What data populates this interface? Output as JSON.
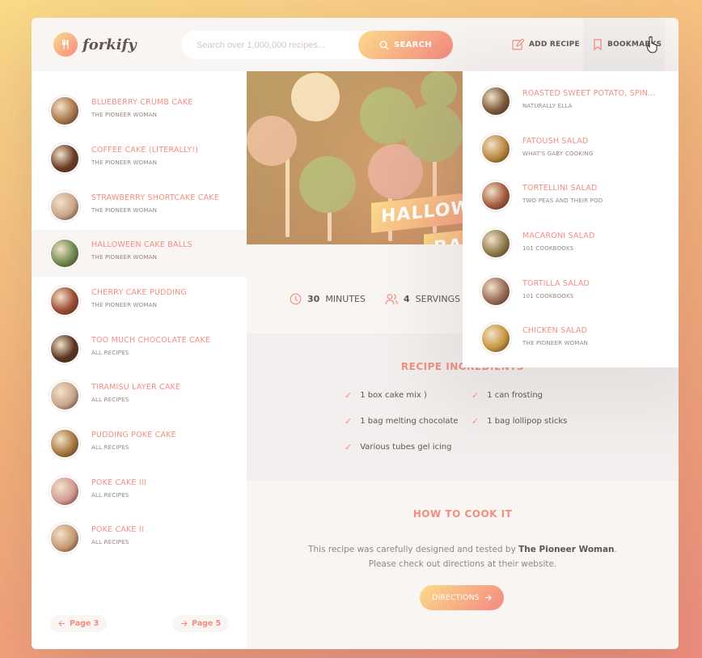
{
  "header": {
    "logo_text": "forkify",
    "search_placeholder": "Search over 1,000,000 recipes...",
    "search_label": "SEARCH",
    "add_recipe_label": "ADD RECIPE",
    "bookmarks_label": "BOOKMARKS"
  },
  "results": [
    {
      "title": "BLUEBERRY CRUMB CAKE",
      "publisher": "THE PIONEER WOMAN",
      "color": "#a9774d"
    },
    {
      "title": "COFFEE CAKE (LITERALLY!)",
      "publisher": "THE PIONEER WOMAN",
      "color": "#6b3c26"
    },
    {
      "title": "STRAWBERRY SHORTCAKE CAKE",
      "publisher": "THE PIONEER WOMAN",
      "color": "#c9a58b"
    },
    {
      "title": "HALLOWEEN CAKE BALLS",
      "publisher": "THE PIONEER WOMAN",
      "color": "#6e8a4e"
    },
    {
      "title": "CHERRY CAKE PUDDING",
      "publisher": "THE PIONEER WOMAN",
      "color": "#9b4a32"
    },
    {
      "title": "TOO MUCH CHOCOLATE CAKE",
      "publisher": "ALL RECIPES",
      "color": "#5b3320"
    },
    {
      "title": "TIRAMISU LAYER CAKE",
      "publisher": "ALL RECIPES",
      "color": "#c9a48c"
    },
    {
      "title": "PUDDING POKE CAKE",
      "publisher": "ALL RECIPES",
      "color": "#a8773f"
    },
    {
      "title": "POKE CAKE III",
      "publisher": "ALL RECIPES",
      "color": "#d39a94"
    },
    {
      "title": "POKE CAKE II",
      "publisher": "ALL RECIPES",
      "color": "#c69a74"
    }
  ],
  "pagination": {
    "prev": "Page 3",
    "next": "Page 5"
  },
  "recipe": {
    "title_line1": "HALLOWEEN",
    "title_line2": "BALLS",
    "minutes": "30",
    "minutes_label": "MINUTES",
    "servings": "4",
    "servings_label": "SERVINGS",
    "ingredients_title": "RECIPE INGREDIENTS",
    "ingredients": [
      "1 box cake mix )",
      "1 can frosting",
      "1 bag melting chocolate",
      "1 bag lollipop sticks",
      "Various tubes gel icing"
    ],
    "cook_title": "HOW TO COOK IT",
    "cook_text_1": "This recipe was carefully designed and tested by ",
    "cook_publisher": "The Pioneer Woman",
    "cook_text_2": ". Please check out directions at their website.",
    "directions_label": "DIRECTIONS"
  },
  "bookmarks": [
    {
      "title": "ROASTED SWEET POTATO, SPINACH...",
      "publisher": "NATURALLY ELLA",
      "color": "#7a5a3a"
    },
    {
      "title": "FATOUSH SALAD",
      "publisher": "WHAT'S GABY COOKING",
      "color": "#b9873f"
    },
    {
      "title": "TORTELLINI SALAD",
      "publisher": "TWO PEAS AND THEIR POD",
      "color": "#a45a3c"
    },
    {
      "title": "MACARONI SALAD",
      "publisher": "101 COOKBOOKS",
      "color": "#8d7a4a"
    },
    {
      "title": "TORTILLA SALAD",
      "publisher": "101 COOKBOOKS",
      "color": "#9a6a56"
    },
    {
      "title": "CHICKEN SALAD",
      "publisher": "THE PIONEER WOMAN",
      "color": "#c7963e"
    }
  ]
}
